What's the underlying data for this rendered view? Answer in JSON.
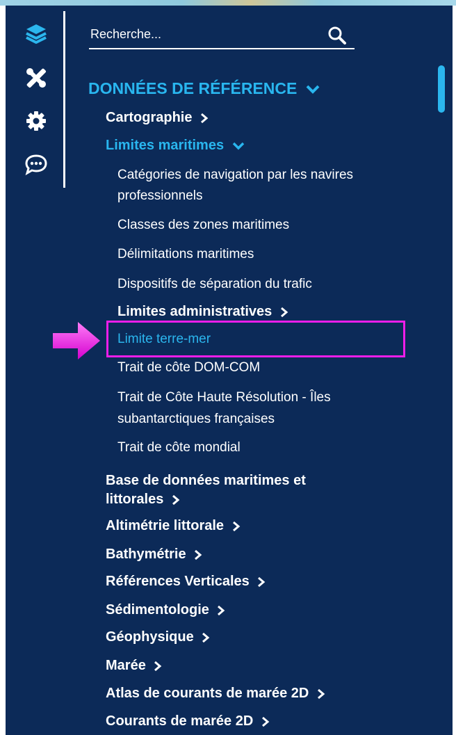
{
  "rail": {
    "icons": [
      "layers-icon",
      "tools-icon",
      "gear-icon",
      "chat-icon"
    ]
  },
  "search": {
    "placeholder": "Recherche..."
  },
  "colors": {
    "panel": "#0c2a58",
    "accent": "#29b6ef",
    "highlight": "#ee1ee9",
    "text": "#ffffff"
  },
  "tree": {
    "root": {
      "label": "DONNÉES DE RÉFÉRENCE"
    },
    "cartographie": "Cartographie",
    "limites_maritimes": {
      "label": "Limites maritimes",
      "items": [
        "Catégories de navigation par les navires",
        "professionnels",
        "Classes des zones maritimes",
        "Délimitations maritimes",
        "Dispositifs de séparation du trafic",
        "Limites administratives",
        "Limite terre-mer",
        "Trait de côte DOM-COM",
        "Trait de Côte Haute Résolution - Îles",
        "subantarctiques françaises",
        "Trait de côte mondial"
      ]
    },
    "categories": [
      "Base de données maritimes et",
      "littorales",
      "Altimétrie littorale",
      "Bathymétrie",
      "Références Verticales",
      "Sédimentologie",
      "Géophysique",
      "Marée",
      "Atlas de courants de marée 2D",
      "Courants de marée 2D"
    ]
  }
}
